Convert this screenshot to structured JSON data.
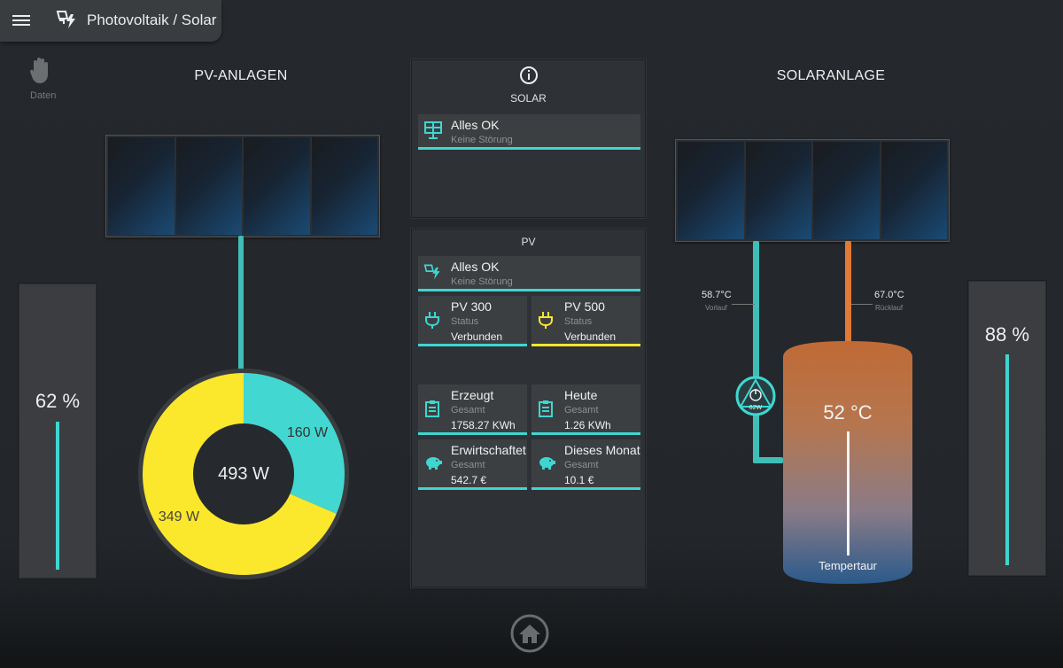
{
  "header": {
    "title": "Photovoltaik / Solar"
  },
  "sidebar": {
    "daten_label": "Daten"
  },
  "pv_anlagen": {
    "title": "PV-ANLAGEN",
    "battery_percent_label": "62 %",
    "battery_level": 0.62,
    "donut": {
      "center": "493 W",
      "seg_a_label": "160 W",
      "seg_b_label": "349 W",
      "seg_a_value": 160,
      "seg_b_value": 349
    }
  },
  "solaranlage": {
    "title": "SOLARANLAGE",
    "vorlauf_temp": "58.7°C",
    "vorlauf_label": "Vorlauf",
    "ruecklauf_temp": "67.0°C",
    "ruecklauf_label": "Rücklauf",
    "pump_label": "62W",
    "tank_temp": "52 °C",
    "tank_label": "Tempertaur",
    "level_percent_label": "88 %",
    "level": 0.88
  },
  "solar_panel": {
    "title": "SOLAR",
    "status": {
      "title": "Alles OK",
      "sub": "Keine Störung"
    }
  },
  "pv_panel": {
    "title": "PV",
    "status": {
      "title": "Alles OK",
      "sub": "Keine Störung"
    },
    "pv300": {
      "title": "PV 300",
      "sub": "Status",
      "value": "Verbunden"
    },
    "pv500": {
      "title": "PV 500",
      "sub": "Status",
      "value": "Verbunden"
    },
    "erzeugt": {
      "title": "Erzeugt",
      "sub": "Gesamt",
      "value": "1758.27 KWh"
    },
    "heute": {
      "title": "Heute",
      "sub": "Gesamt",
      "value": "1.26 KWh"
    },
    "erwirtschaftet": {
      "title": "Erwirtschaftet",
      "sub": "Gesamt",
      "value": "542.7 €"
    },
    "monat": {
      "title": "Dieses Monat",
      "sub": "Gesamt",
      "value": "10.1 €"
    }
  },
  "colors": {
    "accent": "#3fd6d1",
    "yellow": "#fbe72b",
    "orange": "#e07a35"
  },
  "icons": [
    "menu-icon",
    "solar-flash-icon",
    "hand-icon",
    "info-icon",
    "solar-panel-icon",
    "plug-icon",
    "clipboard-icon",
    "piggy-bank-icon",
    "pump-icon",
    "home-icon"
  ]
}
